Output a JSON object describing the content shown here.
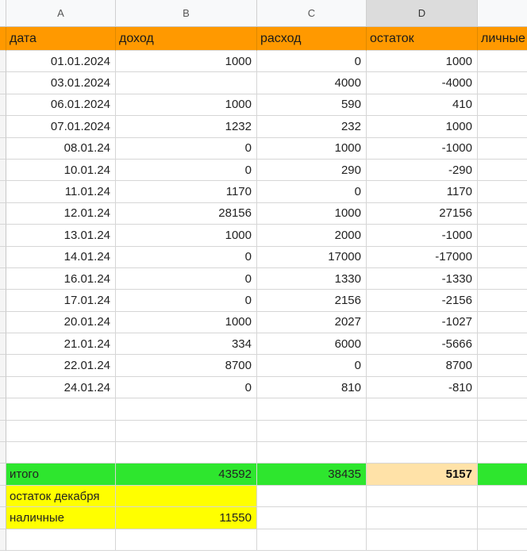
{
  "column_letters": [
    "A",
    "B",
    "C",
    "D"
  ],
  "selected_column": "D",
  "headers": [
    "дата",
    "доход",
    "расход",
    "остаток",
    "личные"
  ],
  "rows": [
    [
      "01.01.2024",
      "1000",
      "0",
      "1000"
    ],
    [
      "03.01.2024",
      "",
      "4000",
      "-4000"
    ],
    [
      "06.01.2024",
      "1000",
      "590",
      "410"
    ],
    [
      "07.01.2024",
      "1232",
      "232",
      "1000"
    ],
    [
      "08.01.24",
      "0",
      "1000",
      "-1000"
    ],
    [
      "10.01.24",
      "0",
      "290",
      "-290"
    ],
    [
      "11.01.24",
      "1170",
      "0",
      "1170"
    ],
    [
      "12.01.24",
      "28156",
      "1000",
      "27156"
    ],
    [
      "13.01.24",
      "1000",
      "2000",
      "-1000"
    ],
    [
      "14.01.24",
      "0",
      "17000",
      "-17000"
    ],
    [
      "16.01.24",
      "0",
      "1330",
      "-1330"
    ],
    [
      "17.01.24",
      "0",
      "2156",
      "-2156"
    ],
    [
      "20.01.24",
      "1000",
      "2027",
      "-1027"
    ],
    [
      "21.01.24",
      "334",
      "6000",
      "-5666"
    ],
    [
      "22.01.24",
      "8700",
      "0",
      "8700"
    ],
    [
      "24.01.24",
      "0",
      "810",
      "-810"
    ]
  ],
  "totals": {
    "label": "итого",
    "income": "43592",
    "expense": "38435",
    "balance": "5157"
  },
  "extra": {
    "december_balance_label": "остаток декабря",
    "cash_label": "наличные",
    "cash_value": "11550"
  },
  "colors": {
    "header_bg": "#ff9900",
    "totals_bg": "#2ee62e",
    "balance_total_bg": "#ffe2a8",
    "extra_bg": "#ffff00"
  }
}
